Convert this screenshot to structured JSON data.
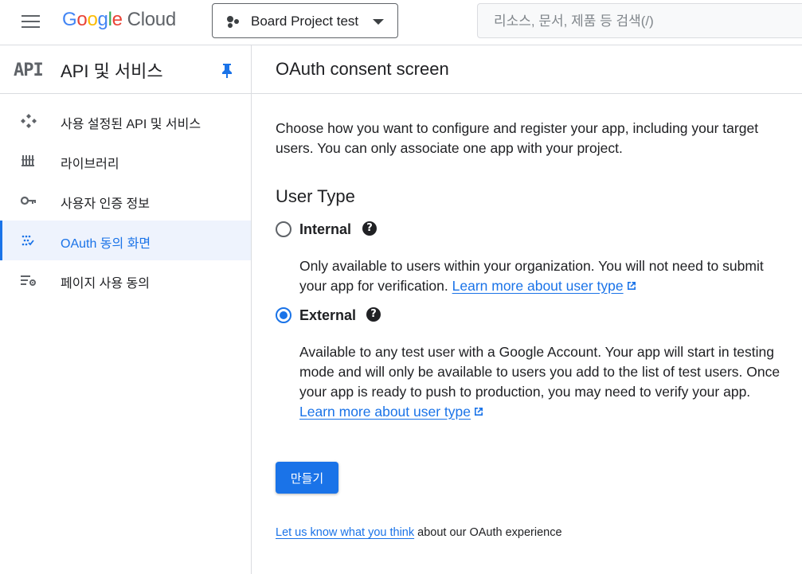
{
  "header": {
    "logo_parts": [
      "G",
      "o",
      "o",
      "g",
      "l",
      "e"
    ],
    "logo_cloud": "Cloud",
    "project_label": "Board Project test",
    "search_placeholder": "리소스, 문서, 제품 등 검색(/)"
  },
  "sidebar": {
    "api_badge": "API",
    "title": "API 및 서비스",
    "items": [
      {
        "label": "사용 설정된 API 및 서비스",
        "icon": "enabled-apis-icon",
        "active": false
      },
      {
        "label": "라이브러리",
        "icon": "library-icon",
        "active": false
      },
      {
        "label": "사용자 인증 정보",
        "icon": "key-icon",
        "active": false
      },
      {
        "label": "OAuth 동의 화면",
        "icon": "oauth-consent-icon",
        "active": true
      },
      {
        "label": "페이지 사용 동의",
        "icon": "page-usage-agreement-icon",
        "active": false
      }
    ]
  },
  "main": {
    "title": "OAuth consent screen",
    "intro": "Choose how you want to configure and register your app, including your target users. You can only associate one app with your project.",
    "user_type_title": "User Type",
    "options": {
      "internal": {
        "label": "Internal",
        "checked": false,
        "desc": "Only available to users within your organization. You will not need to submit your app for verification. ",
        "link": "Learn more about user type"
      },
      "external": {
        "label": "External",
        "checked": true,
        "desc": "Available to any test user with a Google Account. Your app will start in testing mode and will only be available to users you add to the list of test users. Once your app is ready to push to production, you may need to verify your app. ",
        "link": "Learn more about user type"
      }
    },
    "help_glyph": "?",
    "create_button": "만들기",
    "feedback_link": "Let us know what you think",
    "feedback_text": " about our OAuth experience"
  },
  "colors": {
    "accent": "#1a73e8",
    "active_bg": "#eef3fd",
    "divider": "#dadce0"
  }
}
